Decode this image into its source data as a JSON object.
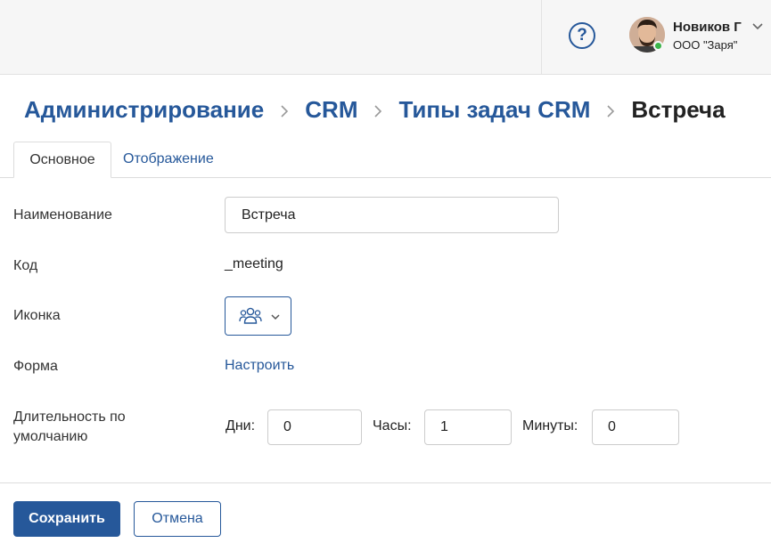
{
  "header": {
    "help_icon": "question-circle-icon",
    "user": {
      "name": "Новиков Г",
      "organization": "ООО \"Заря\"",
      "status": "online",
      "status_color": "#3bb54a"
    }
  },
  "breadcrumb": {
    "items": [
      "Администрирование",
      "CRM",
      "Типы задач CRM"
    ],
    "current": "Встреча"
  },
  "tabs": [
    {
      "label": "Основное",
      "active": true
    },
    {
      "label": "Отображение",
      "active": false
    }
  ],
  "form": {
    "name": {
      "label": "Наименование",
      "value": "Встреча"
    },
    "code": {
      "label": "Код",
      "value": "_meeting"
    },
    "icon": {
      "label": "Иконка",
      "selected_icon": "people-group-icon"
    },
    "form_field": {
      "label": "Форма",
      "link_label": "Настроить"
    },
    "duration": {
      "label": "Длительность по умолчанию",
      "days_label": "Дни:",
      "days": "0",
      "hours_label": "Часы:",
      "hours": "1",
      "minutes_label": "Минуты:",
      "minutes": "0"
    }
  },
  "footer": {
    "save_label": "Сохранить",
    "cancel_label": "Отмена"
  },
  "colors": {
    "accent": "#26589a",
    "header_bg": "#f6f6f6",
    "text": "#333333"
  }
}
